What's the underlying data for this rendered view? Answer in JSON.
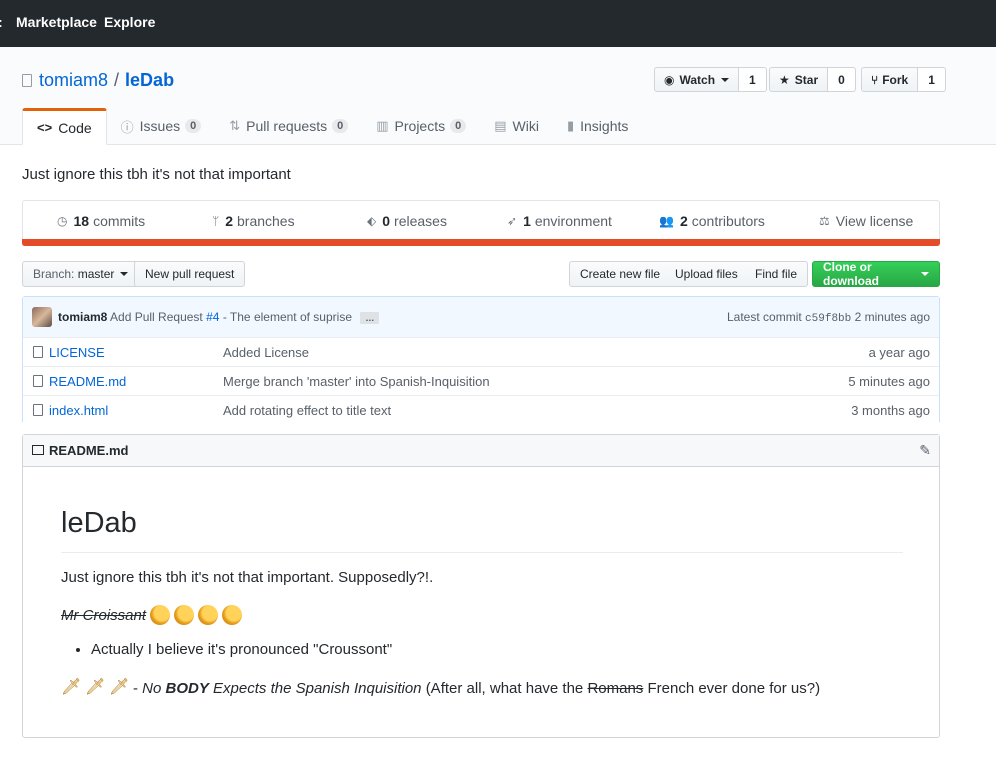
{
  "header": {
    "nav": [
      "Marketplace",
      "Explore"
    ]
  },
  "repo": {
    "owner": "tomiam8",
    "separator": "/",
    "name": "leDab",
    "watch_label": "Watch",
    "watch_count": "1",
    "star_label": "Star",
    "star_count": "0",
    "fork_label": "Fork",
    "fork_count": "1"
  },
  "tabs": [
    {
      "label": "Code",
      "icon": "code-icon"
    },
    {
      "label": "Issues",
      "count": "0",
      "icon": "issue-icon"
    },
    {
      "label": "Pull requests",
      "count": "0",
      "icon": "pr-icon"
    },
    {
      "label": "Projects",
      "count": "0",
      "icon": "project-icon"
    },
    {
      "label": "Wiki",
      "icon": "wiki-icon"
    },
    {
      "label": "Insights",
      "icon": "graph-icon"
    }
  ],
  "description": "Just ignore this tbh it's not that important",
  "summary": {
    "commits_num": "18",
    "commits_label": "commits",
    "branches_num": "2",
    "branches_label": "branches",
    "releases_num": "0",
    "releases_label": "releases",
    "env_num": "1",
    "env_label": "environment",
    "contrib_num": "2",
    "contrib_label": "contributors",
    "license_label": "View license",
    "language_color": "#e34c26"
  },
  "file_nav": {
    "branch_prefix": "Branch:",
    "branch_name": "master",
    "new_pr": "New pull request",
    "create_file": "Create new file",
    "upload_files": "Upload files",
    "find_file": "Find file",
    "clone": "Clone or download"
  },
  "commit": {
    "author": "tomiam8",
    "message_prefix": "Add Pull Request",
    "issue_ref": "#4",
    "message_suffix": "- The element of suprise",
    "ellipsis": "…",
    "latest_label": "Latest commit",
    "sha": "c59f8bb",
    "age": "2 minutes ago"
  },
  "files": [
    {
      "name": "LICENSE",
      "message": "Added License",
      "age": "a year ago"
    },
    {
      "name": "README.md",
      "message": "Merge branch 'master' into Spanish-Inquisition",
      "age": "5 minutes ago"
    },
    {
      "name": "index.html",
      "message": "Add rotating effect to title text",
      "age": "3 months ago"
    }
  ],
  "readme": {
    "filename": "README.md",
    "heading": "leDab",
    "para1": "Just ignore this tbh it's not that important. Supposedly?!.",
    "strike_text": "Mr Croissant",
    "bullet": "Actually I believe it's pronounced \"Croussont\"",
    "p3_dash": "-",
    "p3_no": "No",
    "p3_body": "BODY",
    "p3_expects": "Expects the Spanish Inquisition",
    "p3_after": "(After all, what have the",
    "p3_romans": "Romans",
    "p3_end": "French ever done for us?)"
  }
}
